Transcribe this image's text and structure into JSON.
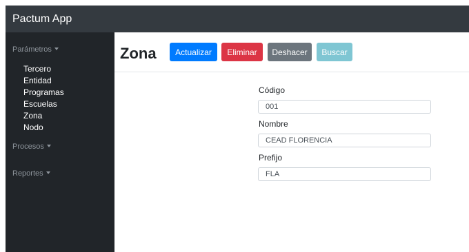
{
  "app": {
    "title": "Pactum App"
  },
  "sidebar": {
    "sections": [
      {
        "label": "Parámetros",
        "items": [
          "Tercero",
          "Entidad",
          "Programas",
          "Escuelas",
          "Zona",
          "Nodo"
        ]
      },
      {
        "label": "Procesos"
      },
      {
        "label": "Reportes"
      }
    ]
  },
  "main": {
    "title": "Zona",
    "buttons": {
      "update": "Actualizar",
      "delete": "Eliminar",
      "undo": "Deshacer",
      "search": "Buscar"
    },
    "form": {
      "codigo": {
        "label": "Código",
        "value": "001"
      },
      "nombre": {
        "label": "Nombre",
        "value": "CEAD FLORENCIA"
      },
      "prefijo": {
        "label": "Prefijo",
        "value": "FLA"
      }
    }
  },
  "colors": {
    "topbar": "#343a40",
    "sidebar": "#212529",
    "primary": "#007bff",
    "danger": "#dc3545",
    "secondary": "#6c757d",
    "info": "#7fc6d3"
  }
}
